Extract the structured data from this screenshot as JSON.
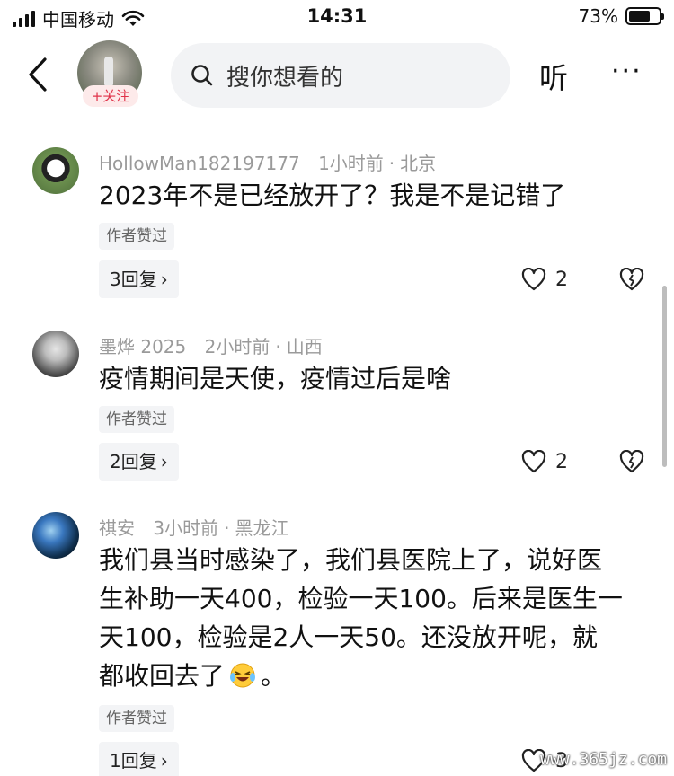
{
  "status_bar": {
    "carrier": "中国移动",
    "time": "14:31",
    "battery": "73%",
    "battery_level": 0.73
  },
  "header": {
    "follow_label": "+关注",
    "search_placeholder": "搜你想看的",
    "listen_label": "听",
    "more_label": "···"
  },
  "comments": [
    {
      "author": "HollowMan182197177",
      "time": "1小时前",
      "location": "北京",
      "text": "2023年不是已经放开了？我是不是记错了",
      "liked_by_author": "作者赞过",
      "replies": "3回复",
      "like_count": "2"
    },
    {
      "author": "墨烨 2025",
      "time": "2小时前",
      "location": "山西",
      "text": "疫情期间是天使，疫情过后是啥",
      "liked_by_author": "作者赞过",
      "replies": "2回复",
      "like_count": "2"
    },
    {
      "author": "祺安",
      "time": "3小时前",
      "location": "黑龙江",
      "text_lines": [
        "我们县当时感染了，我们县医院上了，说好医",
        "生补助一天400，检验一天100。后来是医生一",
        "天100，检验是2人一天50。还没放开呢，就",
        "都收回去了",
        "。"
      ],
      "liked_by_author": "作者赞过",
      "replies": "1回复",
      "like_count": "3"
    }
  ],
  "separator": "·",
  "chevron": "›",
  "watermark": "www.365jz.com"
}
